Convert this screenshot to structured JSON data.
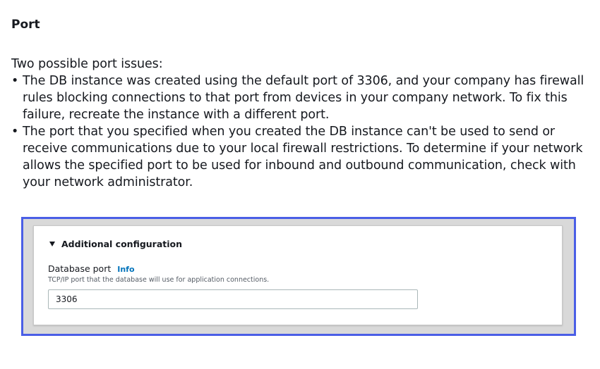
{
  "doc": {
    "heading": "Port",
    "intro": "Two possible port issues:",
    "issues": [
      "The DB instance was created using the default port of 3306, and your company has firewall rules blocking connections to that port from devices in your company network. To fix this failure, recreate the instance with a different port.",
      "The port that you specified when you created the DB instance can't be used to send or receive communications due to your local firewall restrictions. To determine if your network allows the specified port to be used for inbound and outbound communication, check with your network administrator."
    ],
    "bullet": "•"
  },
  "screenshot": {
    "frame_color": "#4a5ee6",
    "section_title": "Additional configuration",
    "caret_icon": "caret-down-icon",
    "field_label": "Database port",
    "info_link": "Info",
    "info_color": "#0073bb",
    "field_description": "TCP/IP port that the database will use for application connections.",
    "port_value": "3306"
  }
}
